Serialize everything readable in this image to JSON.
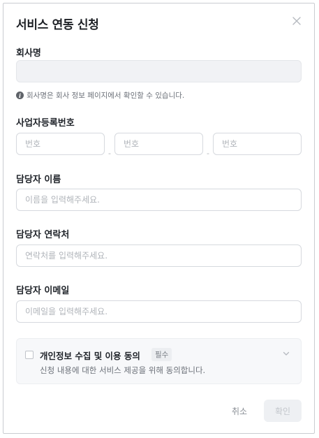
{
  "dialog": {
    "title": "서비스 연동 신청"
  },
  "company": {
    "label": "회사명",
    "value": "",
    "hint": "회사명은 회사 정보 페이지에서 확인할 수 있습니다."
  },
  "business_number": {
    "label": "사업자등록번호",
    "placeholder": "번호",
    "separator": "-"
  },
  "manager_name": {
    "label": "담당자 이름",
    "placeholder": "이름을 입력해주세요."
  },
  "manager_phone": {
    "label": "담당자 연락처",
    "placeholder": "연락처를 입력해주세요."
  },
  "manager_email": {
    "label": "담당자 이메일",
    "placeholder": "이메일을 입력해주세요."
  },
  "consent": {
    "title": "개인정보 수집 및 이용 동의",
    "badge": "필수",
    "description": "신청 내용에 대한 서비스 제공을 위해 동의합니다.",
    "checked": false
  },
  "buttons": {
    "cancel": "취소",
    "confirm": "확인"
  },
  "icons": {
    "close": "close-icon",
    "info": "info-icon",
    "chevron": "chevron-down-icon"
  }
}
